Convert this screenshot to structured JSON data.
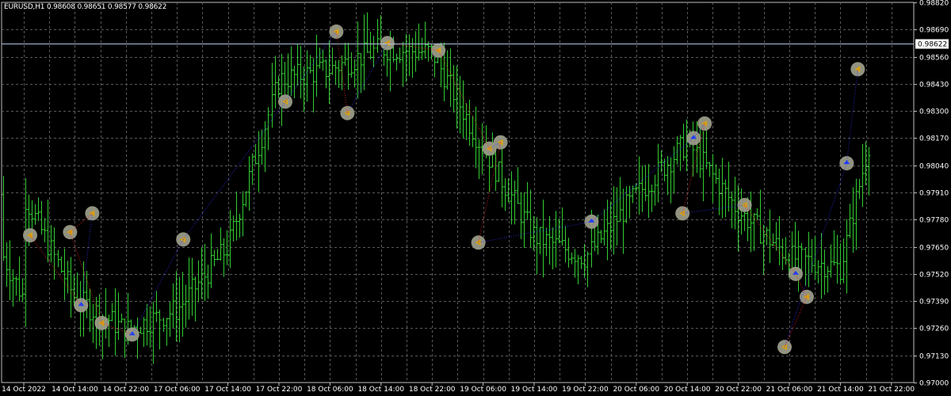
{
  "header": {
    "symbol_line": "EURUSD,H1  0.98608 0.98651 0.98577 0.98622"
  },
  "colors": {
    "background": "#000000",
    "grid": "#5a5a5a",
    "axis": "#c0c0c0",
    "bar": "#32cd32",
    "current_price_line": "#b0c4de",
    "marker_fill": "#9a9a88",
    "marker_arrow_buy": "#1e40ff",
    "marker_arrow_sell": "#ff2a2a",
    "marker_arrow_neutral": "#6b8e23",
    "zigzag_up": "#3030ff",
    "zigzag_down": "#ff2020"
  },
  "price_axis": {
    "labels": [
      "0.98820",
      "0.98690",
      "0.98560",
      "0.98430",
      "0.98300",
      "0.98170",
      "0.98040",
      "0.97910",
      "0.97780",
      "0.97650",
      "0.97520",
      "0.97390",
      "0.97260",
      "0.97130",
      "0.97000"
    ],
    "current_price_label": "0.98622"
  },
  "time_axis": {
    "labels": [
      "14 Oct 2022",
      "14 Oct 14:00",
      "14 Oct 22:00",
      "17 Oct 06:00",
      "17 Oct 14:00",
      "17 Oct 22:00",
      "18 Oct 06:00",
      "18 Oct 14:00",
      "18 Oct 22:00",
      "19 Oct 06:00",
      "19 Oct 14:00",
      "19 Oct 22:00",
      "20 Oct 06:00",
      "20 Oct 14:00",
      "20 Oct 22:00",
      "21 Oct 06:00",
      "21 Oct 14:00",
      "21 Oct 22:00"
    ]
  },
  "chart_data": {
    "type": "line",
    "title": "EURUSD,H1",
    "ylim": [
      0.97,
      0.9882
    ],
    "grid": true,
    "current_price": 0.98622,
    "series": [
      {
        "name": "EURUSD,H1",
        "x": [
          "14 Oct 2022",
          "14 Oct 14:00",
          "14 Oct 22:00",
          "17 Oct 06:00",
          "17 Oct 14:00",
          "17 Oct 22:00",
          "18 Oct 06:00",
          "18 Oct 14:00",
          "18 Oct 22:00",
          "19 Oct 06:00",
          "19 Oct 14:00",
          "19 Oct 22:00",
          "20 Oct 06:00",
          "20 Oct 14:00",
          "20 Oct 22:00",
          "21 Oct 06:00",
          "21 Oct 14:00",
          "21 Oct 22:00"
        ],
        "close": [
          0.979,
          0.974,
          0.9725,
          0.9735,
          0.9765,
          0.9845,
          0.985,
          0.986,
          0.9858,
          0.9812,
          0.977,
          0.976,
          0.979,
          0.9815,
          0.9782,
          0.976,
          0.9755,
          0.9862
        ]
      }
    ],
    "signals": [
      {
        "x": "14 Oct 2022",
        "y": 0.97705,
        "dir": "sell"
      },
      {
        "x": "14 Oct 14:00",
        "y": 0.9737,
        "dir": "buy"
      },
      {
        "x": "14 Oct 14:00",
        "y": 0.9781,
        "dir": "sell"
      },
      {
        "x": "14 Oct 14:00",
        "y": 0.9772,
        "dir": "sell"
      },
      {
        "x": "14 Oct 14:00",
        "y": 0.97285,
        "dir": "sell"
      },
      {
        "x": "14 Oct 22:00",
        "y": 0.9723,
        "dir": "buy"
      },
      {
        "x": "17 Oct 06:00",
        "y": 0.97685,
        "dir": "sell"
      },
      {
        "x": "17 Oct 22:00",
        "y": 0.98345,
        "dir": "sell"
      },
      {
        "x": "18 Oct 06:00",
        "y": 0.9868,
        "dir": "sell"
      },
      {
        "x": "18 Oct 06:00",
        "y": 0.9829,
        "dir": "sell"
      },
      {
        "x": "18 Oct 14:00",
        "y": 0.98625,
        "dir": "sell"
      },
      {
        "x": "18 Oct 22:00",
        "y": 0.9859,
        "dir": "sell"
      },
      {
        "x": "19 Oct 06:00",
        "y": 0.9812,
        "dir": "sell"
      },
      {
        "x": "19 Oct 06:00",
        "y": 0.9815,
        "dir": "sell"
      },
      {
        "x": "19 Oct 06:00",
        "y": 0.9767,
        "dir": "sell"
      },
      {
        "x": "19 Oct 22:00",
        "y": 0.9777,
        "dir": "buy"
      },
      {
        "x": "20 Oct 14:00",
        "y": 0.9817,
        "dir": "buy"
      },
      {
        "x": "20 Oct 14:00",
        "y": 0.9824,
        "dir": "sell"
      },
      {
        "x": "20 Oct 14:00",
        "y": 0.9781,
        "dir": "sell"
      },
      {
        "x": "20 Oct 22:00",
        "y": 0.9785,
        "dir": "sell"
      },
      {
        "x": "21 Oct 06:00",
        "y": 0.9752,
        "dir": "buy"
      },
      {
        "x": "21 Oct 06:00",
        "y": 0.9741,
        "dir": "sell"
      },
      {
        "x": "21 Oct 06:00",
        "y": 0.9717,
        "dir": "sell"
      },
      {
        "x": "21 Oct 14:00",
        "y": 0.9805,
        "dir": "buy"
      },
      {
        "x": "21 Oct 14:00",
        "y": 0.985,
        "dir": "sell"
      }
    ]
  }
}
